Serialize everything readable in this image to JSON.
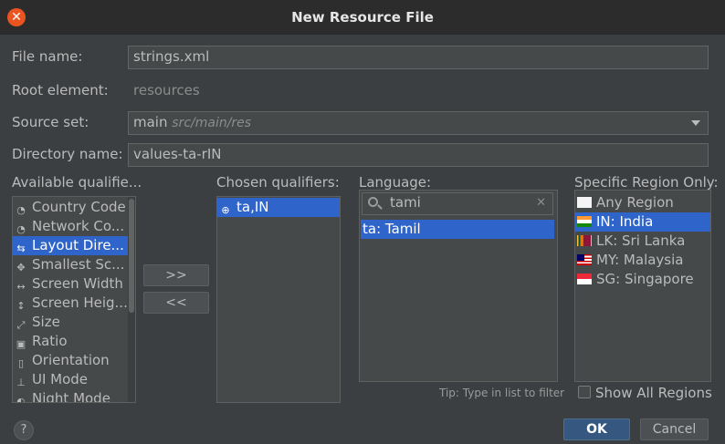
{
  "window": {
    "title": "New Resource File"
  },
  "form": {
    "file_name_label": "File name:",
    "file_name_value": "strings.xml",
    "root_element_label": "Root element:",
    "root_element_value": "resources",
    "source_set_label": "Source set:",
    "source_set_value": "main",
    "source_set_hint": "src/main/res",
    "directory_label": "Directory name:",
    "directory_value": "values-ta-rIN"
  },
  "available": {
    "header": "Available qualifie...",
    "items": [
      {
        "label": "Country Code",
        "icon": "country-code-icon",
        "glyph": "◔"
      },
      {
        "label": "Network Co...",
        "icon": "network-code-icon",
        "glyph": "◔"
      },
      {
        "label": "Layout Dire...",
        "icon": "layout-direction-icon",
        "glyph": "⇆"
      },
      {
        "label": "Smallest Sc...",
        "icon": "smallest-screen-icon",
        "glyph": "✥"
      },
      {
        "label": "Screen Width",
        "icon": "screen-width-icon",
        "glyph": "↔"
      },
      {
        "label": "Screen Heig...",
        "icon": "screen-height-icon",
        "glyph": "↕"
      },
      {
        "label": "Size",
        "icon": "size-icon",
        "glyph": "⤢"
      },
      {
        "label": "Ratio",
        "icon": "ratio-icon",
        "glyph": "▣"
      },
      {
        "label": "Orientation",
        "icon": "orientation-icon",
        "glyph": "▯"
      },
      {
        "label": "UI Mode",
        "icon": "ui-mode-icon",
        "glyph": "⊥"
      },
      {
        "label": "Night Mode",
        "icon": "night-mode-icon",
        "glyph": "◐"
      }
    ],
    "selected_index": 2
  },
  "buttons": {
    "add": ">>",
    "remove": "<<",
    "ok": "OK",
    "cancel": "Cancel",
    "help": "?"
  },
  "chosen": {
    "header": "Chosen qualifiers:",
    "items": [
      {
        "label": "ta,IN",
        "icon": "globe-icon"
      }
    ]
  },
  "language": {
    "header": "Language:",
    "search_value": "tami",
    "items": [
      {
        "label": "ta: Tamil"
      }
    ],
    "tip": "Tip: Type in list to filter"
  },
  "region": {
    "header": "Specific Region Only:",
    "items": [
      {
        "label": "Any Region",
        "flag": "blank-flag-icon"
      },
      {
        "label": "IN: India",
        "flag": "india-flag-icon"
      },
      {
        "label": "LK: Sri Lanka",
        "flag": "sri-lanka-flag-icon"
      },
      {
        "label": "MY: Malaysia",
        "flag": "malaysia-flag-icon"
      },
      {
        "label": "SG: Singapore",
        "flag": "singapore-flag-icon"
      }
    ],
    "selected_index": 1,
    "show_all_label": "Show All Regions",
    "show_all_checked": false
  },
  "colors": {
    "selection": "#2f65ca",
    "background": "#3c3f41",
    "field": "#45494a",
    "close": "#e95420",
    "primary_button": "#365880"
  }
}
